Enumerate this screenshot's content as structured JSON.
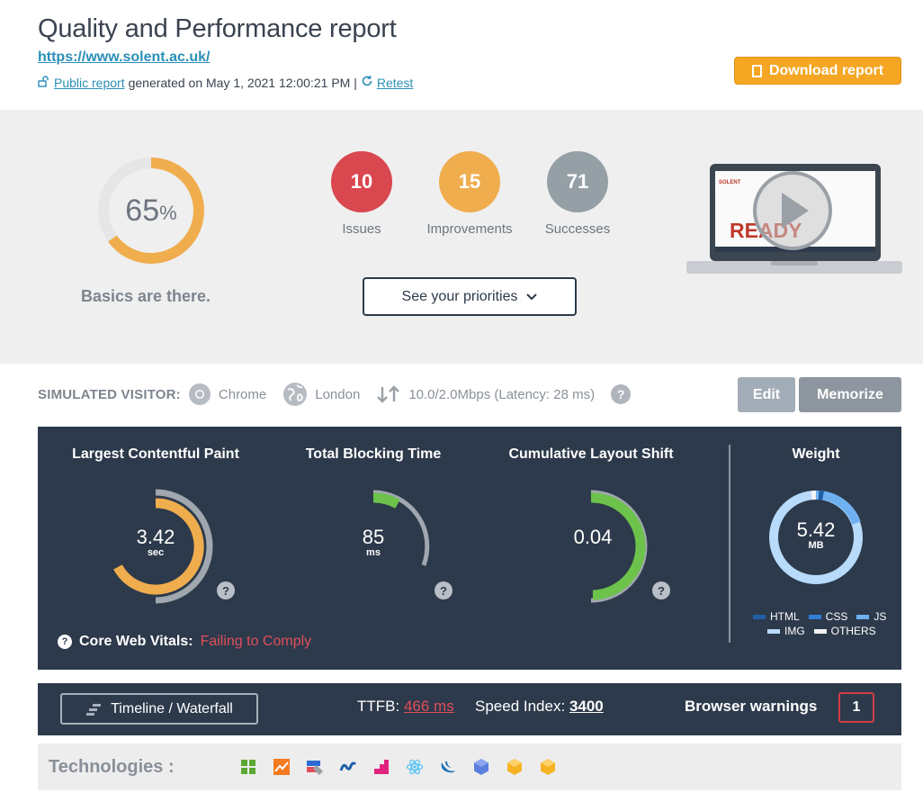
{
  "header": {
    "title": "Quality and Performance report",
    "url": "https://www.solent.ac.uk/",
    "public_report_label": "Public report",
    "generated_text": "generated on May 1, 2021 12:00:21 PM |",
    "retest_label": "Retest",
    "download_label": "Download report"
  },
  "summary": {
    "score": "65",
    "score_unit": "%",
    "score_fraction": 0.65,
    "caption": "Basics are there.",
    "badges": [
      {
        "value": "10",
        "label": "Issues",
        "color": "#d9474f"
      },
      {
        "value": "15",
        "label": "Improvements",
        "color": "#f0ad4e"
      },
      {
        "value": "71",
        "label": "Successes",
        "color": "#95a0a6"
      }
    ],
    "priorities_label": "See your priorities",
    "preview_text": "READY"
  },
  "visitor": {
    "label": "SIMULATED VISITOR:",
    "browser": "Chrome",
    "location": "London",
    "connection": "10.0/2.0Mbps (Latency: 28 ms)",
    "edit_label": "Edit",
    "memorize_label": "Memorize"
  },
  "metrics": {
    "lcp": {
      "title": "Largest Contentful Paint",
      "value": "3.42",
      "unit": "sec",
      "color": "#f0ad4e"
    },
    "tbt": {
      "title": "Total Blocking Time",
      "value": "85",
      "unit": "ms",
      "color": "#6dc24b"
    },
    "cls": {
      "title": "Cumulative Layout Shift",
      "value": "0.04",
      "unit": "",
      "color": "#6dc24b"
    },
    "weight": {
      "title": "Weight",
      "value": "5.42",
      "unit": "MB"
    },
    "help": "?",
    "cwv_label": "Core Web Vitals:",
    "cwv_status": "Failing to Comply",
    "legend": [
      {
        "label": "HTML",
        "color": "#1f5fa8"
      },
      {
        "label": "CSS",
        "color": "#2f7fd6"
      },
      {
        "label": "JS",
        "color": "#6fb1f0"
      },
      {
        "label": "IMG",
        "color": "#b8dbfb"
      },
      {
        "label": "OTHERS",
        "color": "#f2f2f2"
      }
    ]
  },
  "bottom": {
    "timeline_label": "Timeline / Waterfall",
    "ttfb_label": "TTFB:",
    "ttfb_value": "466 ms",
    "si_label": "Speed Index:",
    "si_value": "3400",
    "warnings_label": "Browser warnings",
    "warnings_count": "1"
  },
  "technologies": {
    "label": "Technologies :",
    "icons": [
      "windows-tiles-icon",
      "chart-icon",
      "tag-manager-icon",
      "wave-icon",
      "stairs-icon",
      "react-icon",
      "jquery-icon",
      "cube-icon",
      "box-icon",
      "box-icon"
    ]
  }
}
